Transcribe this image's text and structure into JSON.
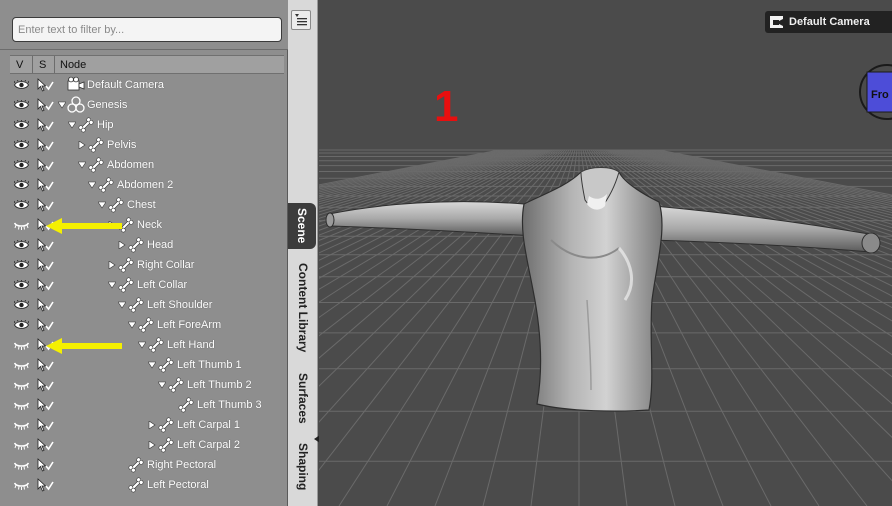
{
  "scene_pane": {
    "filter_placeholder": "Enter text to filter by...",
    "columns": {
      "visible": "V",
      "selectable": "S",
      "node": "Node"
    },
    "nodes": [
      {
        "label": "Default Camera",
        "icon": "camera-icon",
        "expander": "none"
      },
      {
        "label": "Genesis",
        "icon": "figure-icon",
        "expander": "expanded"
      },
      {
        "label": "Hip",
        "icon": "bone-icon",
        "expander": "expanded"
      },
      {
        "label": "Pelvis",
        "icon": "bone-icon",
        "expander": "collapsed"
      },
      {
        "label": "Abdomen",
        "icon": "bone-icon",
        "expander": "expanded"
      },
      {
        "label": "Abdomen 2",
        "icon": "bone-icon",
        "expander": "expanded"
      },
      {
        "label": "Chest",
        "icon": "bone-icon",
        "expander": "expanded"
      },
      {
        "label": "Neck",
        "icon": "bone-icon",
        "expander": "collapsed"
      },
      {
        "label": "Head",
        "icon": "bone-icon",
        "expander": "collapsed"
      },
      {
        "label": "Right Collar",
        "icon": "bone-icon",
        "expander": "collapsed"
      },
      {
        "label": "Left Collar",
        "icon": "bone-icon",
        "expander": "expanded"
      },
      {
        "label": "Left Shoulder",
        "icon": "bone-icon",
        "expander": "expanded"
      },
      {
        "label": "Left ForeArm",
        "icon": "bone-icon",
        "expander": "expanded"
      },
      {
        "label": "Left Hand",
        "icon": "bone-icon",
        "expander": "expanded"
      },
      {
        "label": "Left Thumb 1",
        "icon": "bone-icon",
        "expander": "expanded"
      },
      {
        "label": "Left Thumb 2",
        "icon": "bone-icon",
        "expander": "expanded"
      },
      {
        "label": "Left Thumb 3",
        "icon": "bone-icon",
        "expander": "none"
      },
      {
        "label": "Left Carpal 1",
        "icon": "bone-icon",
        "expander": "collapsed"
      },
      {
        "label": "Left Carpal 2",
        "icon": "bone-icon",
        "expander": "collapsed"
      },
      {
        "label": "Right Pectoral",
        "icon": "bone-icon",
        "expander": "none"
      },
      {
        "label": "Left Pectoral",
        "icon": "bone-icon",
        "expander": "none"
      }
    ],
    "hidden_rows": [
      7,
      13,
      14,
      15,
      16,
      17,
      18,
      19,
      20
    ],
    "highlighted_rows": [
      7,
      13
    ]
  },
  "tabs": [
    {
      "label": "Scene",
      "active": true
    },
    {
      "label": "Content Library",
      "active": false
    },
    {
      "label": "Surfaces",
      "active": false
    },
    {
      "label": "Shaping",
      "active": false
    }
  ],
  "viewport": {
    "camera_label": "Default Camera",
    "annotation_number": "1",
    "view_cube_label": "Fro"
  },
  "colors": {
    "pane_bg": "#8e8e8e",
    "viewport_bg": "#4b4b4b",
    "arrow_yellow": "#f5f000",
    "annotation_red": "#e80f0f",
    "active_tab": "#3c3c3c"
  }
}
